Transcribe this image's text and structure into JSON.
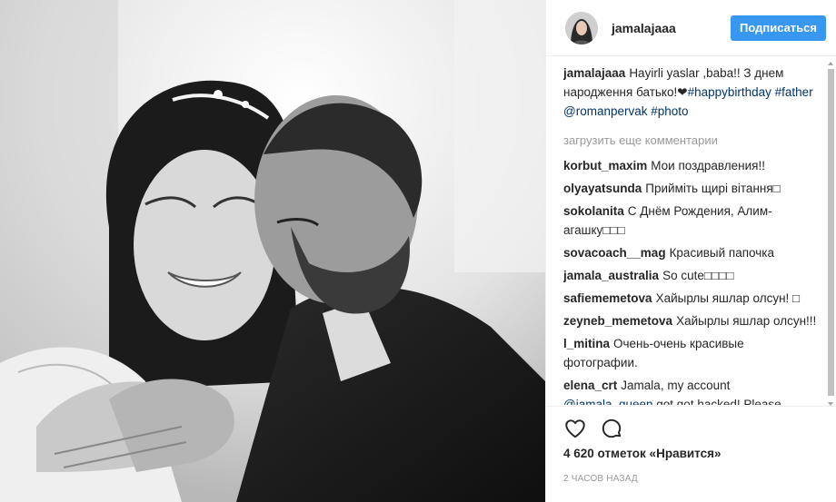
{
  "post": {
    "image_alt": "Black-and-white photo: bride dancing with her father",
    "author": "jamalajaaa",
    "follow_label": "Подписаться",
    "caption": {
      "user": "jamalajaaa",
      "text": "Hayirli yaslar ,baba!! З днем народження батько!❤",
      "tags": [
        "#happybirthday",
        "#father",
        "@romanpervak",
        "#photo"
      ]
    },
    "load_more": "загрузить еще комментарии",
    "comments": [
      {
        "user": "korbut_maxim",
        "text": "Мои поздравления!!"
      },
      {
        "user": "olyayatsunda",
        "text": "Прийміть щирі вітання□"
      },
      {
        "user": "sokolanita",
        "text": "С Днём Рождения, Алим-агашку□□□"
      },
      {
        "user": "sovacoach__mag",
        "text": "Красивый папочка"
      },
      {
        "user": "jamala_australia",
        "text": "So cute□□□□"
      },
      {
        "user": "safiememetova",
        "text": "Хайырлы яшлар олсун! □"
      },
      {
        "user": "zeyneb_memetova",
        "text": "Хайырлы яшлар олсун!!!"
      },
      {
        "user": "l_mitina",
        "text": "Очень-очень красивые фотографии."
      },
      {
        "user": "elena_crt",
        "text_before": "Jamala, my account ",
        "mention": "@jamala_queen",
        "text_after": " got got hacked! Please"
      }
    ],
    "likes": "4 620 отметок «Нравится»",
    "time": "2 ЧАСОВ НАЗАД"
  },
  "icons": {
    "like": "heart-icon",
    "comment": "comment-bubble-icon"
  },
  "colors": {
    "follow_button": "#3897f0",
    "link": "#003569",
    "muted": "#999999"
  }
}
